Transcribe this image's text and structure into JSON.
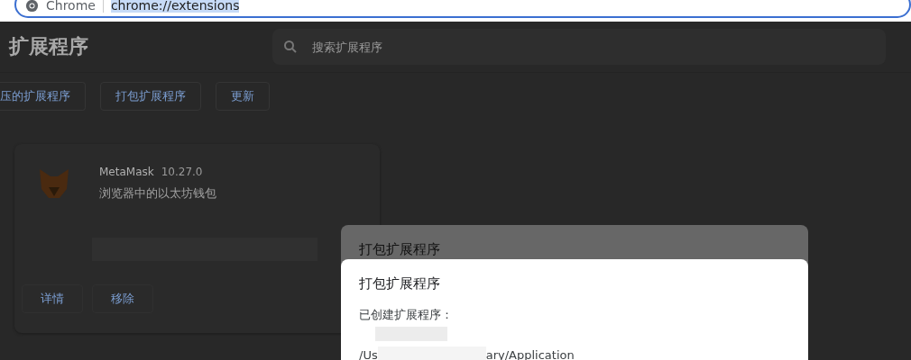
{
  "address_bar": {
    "site_label": "Chrome",
    "url": "chrome://extensions"
  },
  "header": {
    "title": "扩展程序",
    "search": {
      "placeholder": "搜索扩展程序"
    }
  },
  "toolbar": {
    "buttons": [
      "压的扩展程序",
      "打包扩展程序",
      "更新"
    ]
  },
  "extension_card": {
    "name": "MetaMask",
    "version": "10.27.0",
    "description": "浏览器中的以太坊钱包",
    "buttons": [
      "详情",
      "移除"
    ]
  },
  "dialog_behind": {
    "title": "打包扩展程序"
  },
  "dialog": {
    "title": "打包扩展程序",
    "message": "已创建扩展程序：",
    "path_start": "/Us",
    "path_end": "ary/Application"
  }
}
